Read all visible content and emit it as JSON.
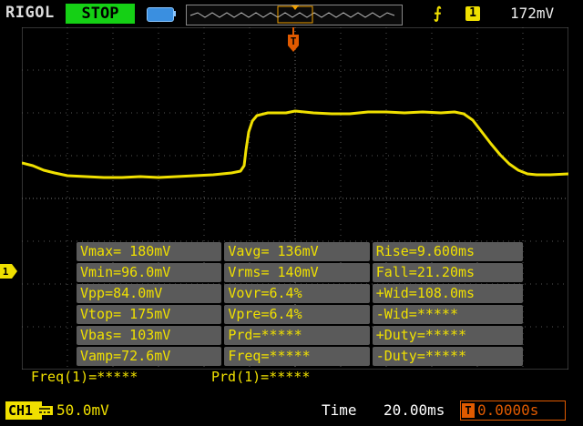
{
  "header": {
    "brand": "RIGOL",
    "run_state": "STOP",
    "trigger_edge_icon": "rising-edge-icon",
    "trigger_source": "1",
    "trigger_level": "172mV"
  },
  "markers": {
    "trigger_position": "T",
    "channel": "1"
  },
  "measurements": [
    [
      "Vmax= 180mV",
      "Vavg= 136mV",
      "Rise=9.600ms"
    ],
    [
      "Vmin=96.0mV",
      "Vrms= 140mV",
      "Fall=21.20ms"
    ],
    [
      "Vpp=84.0mV",
      "Vovr=6.4%",
      "+Wid=108.0ms"
    ],
    [
      "Vtop= 175mV",
      "Vpre=6.4%",
      "-Wid=*****"
    ],
    [
      "Vbas= 103mV",
      "Prd=*****",
      "+Duty=*****"
    ],
    [
      "Vamp=72.6mV",
      "Freq=*****",
      "-Duty=*****"
    ]
  ],
  "counters": {
    "freq": "Freq(1)=*****",
    "prd": "Prd(1)=*****"
  },
  "footer": {
    "channel_label": "CH1",
    "scale": "50.0mV",
    "timebase_label": "Time",
    "timebase": "20.00ms",
    "trigger_icon": "T",
    "trigger_offset": "0.0000s"
  },
  "colors": {
    "trace": "#f0e000",
    "run_stop": "#15d015",
    "trigger": "#e05a00",
    "cell_bg": "#5a5a5a"
  }
}
